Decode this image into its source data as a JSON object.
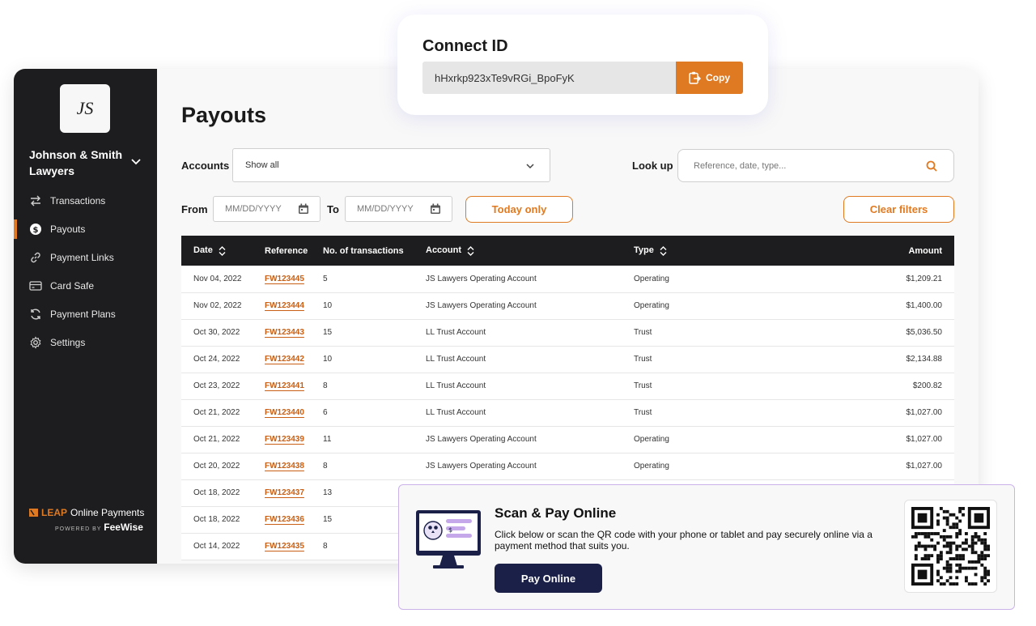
{
  "sidebar": {
    "logo_text": "JS",
    "firm_name": "Johnson & Smith Lawyers",
    "items": [
      {
        "label": "Transactions",
        "icon": "arrows-swap-icon"
      },
      {
        "label": "Payouts",
        "icon": "dollar-circle-icon",
        "active": true
      },
      {
        "label": "Payment Links",
        "icon": "link-icon"
      },
      {
        "label": "Card Safe",
        "icon": "card-icon"
      },
      {
        "label": "Payment Plans",
        "icon": "refresh-icon"
      },
      {
        "label": "Settings",
        "icon": "gear-icon"
      }
    ],
    "brand_leap": "LEAP",
    "brand_rest": "Online Payments",
    "brand_powered": "POWERED BY",
    "brand_feewise": "FeeWise"
  },
  "main": {
    "title": "Payouts",
    "accounts_label": "Accounts",
    "accounts_value": "Show all",
    "lookup_label": "Look up",
    "lookup_placeholder": "Reference, date, type...",
    "from_label": "From",
    "to_label": "To",
    "from_placeholder": "MM/DD/YYYY",
    "to_placeholder": "MM/DD/YYYY",
    "today_only": "Today only",
    "clear_filters": "Clear filters"
  },
  "table": {
    "headers": {
      "date": "Date",
      "reference": "Reference",
      "count": "No. of transactions",
      "account": "Account",
      "type": "Type",
      "amount": "Amount"
    },
    "rows": [
      {
        "date": "Nov 04, 2022",
        "ref": "FW123445",
        "count": "5",
        "account": "JS Lawyers Operating Account",
        "type": "Operating",
        "amount": "$1,209.21"
      },
      {
        "date": "Nov 02, 2022",
        "ref": "FW123444",
        "count": "10",
        "account": "JS Lawyers Operating Account",
        "type": "Operating",
        "amount": "$1,400.00"
      },
      {
        "date": "Oct 30, 2022",
        "ref": "FW123443",
        "count": "15",
        "account": "LL Trust Account",
        "type": "Trust",
        "amount": "$5,036.50"
      },
      {
        "date": "Oct 24, 2022",
        "ref": "FW123442",
        "count": "10",
        "account": "LL Trust Account",
        "type": "Trust",
        "amount": "$2,134.88"
      },
      {
        "date": "Oct 23, 2022",
        "ref": "FW123441",
        "count": "8",
        "account": "LL Trust Account",
        "type": "Trust",
        "amount": "$200.82"
      },
      {
        "date": "Oct 21, 2022",
        "ref": "FW123440",
        "count": "6",
        "account": "LL Trust Account",
        "type": "Trust",
        "amount": "$1,027.00"
      },
      {
        "date": "Oct 21, 2022",
        "ref": "FW123439",
        "count": "11",
        "account": "JS Lawyers Operating Account",
        "type": "Operating",
        "amount": "$1,027.00"
      },
      {
        "date": "Oct 20, 2022",
        "ref": "FW123438",
        "count": "8",
        "account": "JS Lawyers Operating Account",
        "type": "Operating",
        "amount": "$1,027.00"
      },
      {
        "date": "Oct 18, 2022",
        "ref": "FW123437",
        "count": "13",
        "account": "",
        "type": "",
        "amount": ""
      },
      {
        "date": "Oct 18, 2022",
        "ref": "FW123436",
        "count": "15",
        "account": "",
        "type": "",
        "amount": ""
      },
      {
        "date": "Oct 14, 2022",
        "ref": "FW123435",
        "count": "8",
        "account": "",
        "type": "",
        "amount": ""
      }
    ]
  },
  "connect": {
    "title": "Connect ID",
    "value": "hHxrkp923xTe9vRGi_BpoFyK",
    "copy_label": "Copy"
  },
  "scan": {
    "title": "Scan & Pay Online",
    "text": "Click below or scan the QR code with your phone or tablet and pay securely online via a payment method that suits you.",
    "button": "Pay Online"
  },
  "colors": {
    "accent": "#e07a22",
    "sidebar_bg": "#1d1d1f",
    "pay_button": "#1a2048"
  }
}
